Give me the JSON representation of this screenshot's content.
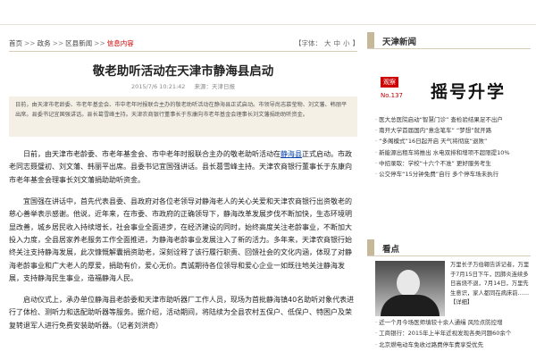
{
  "breadcrumb": {
    "items": [
      "首页",
      "政务",
      "区县新闻"
    ],
    "current": "信息内容"
  },
  "font_size": {
    "label": "【字体：",
    "large": "大",
    "medium": "中",
    "small": "小",
    "close": "】"
  },
  "article": {
    "title": "敬老助听活动在天津市静海县启动",
    "date": "2015/7/6 10:21:42",
    "source": "来源：天津日报",
    "summary": "日前，由天津市老龄委、市老年基金会、市中老年时报联合主办的敬老助听活动在静海县正式启动。市领导尚志慕莹物、刘文藩、韩丽平出席。县委书记宜国强讲话。县长葛雪峰主持。天津农商银行董事长于东康向市老年基金会理事长刘文藩捐助助听资金。",
    "p1_a": "日前，由天津市老龄委、市老年基金会、市中老年时报联合主办的敬老助听活动在",
    "p1_link": "静海县",
    "p1_b": "正式启动。市政老同志聂璧初、刘文藩、韩丽平出席。县委书记宜国强讲话。县长葛雪峰主持。天津农商银行董事长于东康向市老年基金会理事长刘文藩捐助助听资金。",
    "p2": "宜国强在讲话中，首先代表县委、县政府对各位老领导对静海老人的关心关爱和天津农商银行出资敬老的慈心善举表示感谢。他说，近年来，在市委、市政府的正确领导下，静海改革发展步伐不断加快，生态环境明显改善，城乡居民收入持续增长，社会事业全面进步，在经济建设的同时，始终高度关注老龄事业，不断加大投入力度，全县居家养老服务工作全面推进，为静海老龄事业发展注入了新的活力。多年来，天津农商银行始终关注支持静海发展，此次慷慨解囊捐资助老，深刻诠释了该行履行职责、回馈社会的文化内涵，体现了对静海老龄事业和广大老人的厚爱，捐助有价，爱心无价。真诚期待各位领导和爱心企业一如既往地关注静海发展，支持静海民生事业，造福静海人民。",
    "p3": "启动仪式上，承办单位静海县老龄委和天津市助听器厂工作人员，现场为首批静海镇40名助听对象代表进行了体检、测听力和选配助听器等服务。据介绍，活动期间，将陆续为全县农村五保户、低保户、特困户及荣复转退军人进行免费安装助听器。（记者刘洪奇）"
  },
  "sidebar": {
    "tianjin_news_label": "天津新闻",
    "promo": {
      "tag": "观察",
      "no": "No.137",
      "title": "摇号升学"
    },
    "news": [
      "医大总医院启动“智慧门诊” 查检验结果足不出户",
      "南开大学首届国内“意念笔车” “梦想”就开路",
      "“多阁模式”16日起开启 天气将彻底“退败”",
      "新能源出租车将推出 水电双排和增项不超限提10%",
      "中招录取：学校“十六个不准” 更好服务考生",
      "公交停车“15分钟免费”自行 多个停车场未执行"
    ],
    "kandian_label": "看点",
    "photo_caption": "万里长子万伯翱告诉记者，万里于7月15日下午，因肺炎连续多日高烧不退，7月14日，万里先生意识，家人都同在病床前……【详细】",
    "news2": [
      "近一个月今场医师填较十余人通缉 风险点防控增",
      "工商银行：2015年上半年近视发现各类问题60余个",
      "北京燃电动车免收过路费停车费享受优先"
    ]
  },
  "colors": {
    "accent_red": "#cc0000",
    "summary_bg": "#f5f0e6",
    "rule": "#d9cdb8",
    "link": "#0645ad"
  }
}
